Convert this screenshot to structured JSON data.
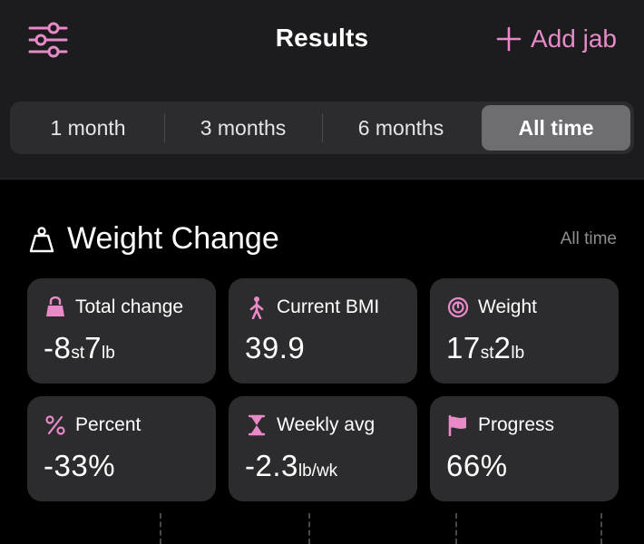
{
  "header": {
    "title": "Results",
    "add_button": "Add jab",
    "settings_icon": "sliders-icon",
    "accent_color": "#e889c8"
  },
  "range_tabs": {
    "items": [
      {
        "label": "1 month",
        "active": false
      },
      {
        "label": "3 months",
        "active": false
      },
      {
        "label": "6 months",
        "active": false
      },
      {
        "label": "All time",
        "active": true
      }
    ]
  },
  "weight_change": {
    "icon": "scale-weight-icon",
    "title": "Weight Change",
    "range": "All time",
    "cards": [
      {
        "icon": "kettlebell-icon",
        "label": "Total change",
        "value": [
          {
            "t": "-8"
          },
          {
            "t": "st",
            "u": true
          },
          {
            "t": "7"
          },
          {
            "t": "lb",
            "u": true
          }
        ]
      },
      {
        "icon": "person-icon",
        "label": "Current BMI",
        "value": [
          {
            "t": "39.9"
          }
        ]
      },
      {
        "icon": "scale-dial-icon",
        "label": "Weight",
        "value": [
          {
            "t": "17"
          },
          {
            "t": "st",
            "u": true
          },
          {
            "t": "2"
          },
          {
            "t": "lb",
            "u": true
          }
        ]
      },
      {
        "icon": "percent-icon",
        "label": "Percent",
        "value": [
          {
            "t": "-33%"
          }
        ]
      },
      {
        "icon": "hourglass-icon",
        "label": "Weekly avg",
        "value": [
          {
            "t": "-2.3"
          },
          {
            "t": "lb/wk",
            "u": true
          }
        ]
      },
      {
        "icon": "flag-icon",
        "label": "Progress",
        "value": [
          {
            "t": "66%"
          }
        ]
      }
    ]
  }
}
